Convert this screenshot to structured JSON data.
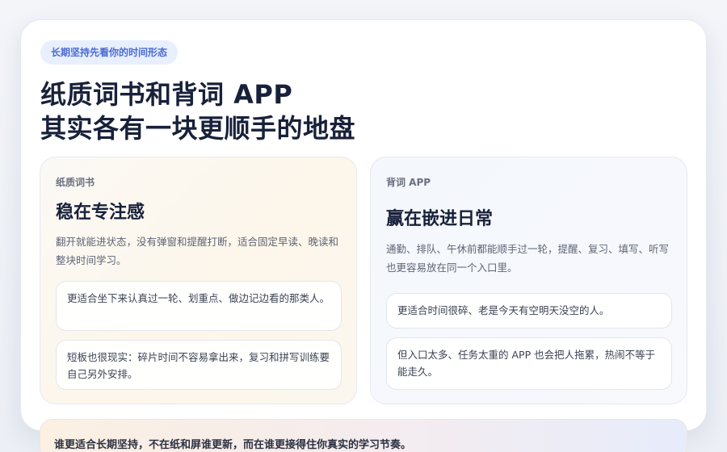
{
  "header": {
    "badge": "长期坚持先看你的时间形态",
    "title_line1": "纸质词书和背词 APP",
    "title_line2": "其实各有一块更顺手的地盘"
  },
  "panels": [
    {
      "label": "纸质词书",
      "title": "稳在专注感",
      "description": "翻开就能进状态，没有弹窗和提醒打断，适合固定早读、晚读和整块时间学习。",
      "notes": [
        "更适合坐下来认真过一轮、划重点、做边记边看的那类人。",
        "短板也很现实：碎片时间不容易拿出来，复习和拼写训练要自己另外安排。"
      ]
    },
    {
      "label": "背词 APP",
      "title": "赢在嵌进日常",
      "description": "通勤、排队、午休前都能顺手过一轮，提醒、复习、填写、听写也更容易放在同一个入口里。",
      "notes": [
        "更适合时间很碎、老是今天有空明天没空的人。",
        "但入口太多、任务太重的 APP 也会把人拖累，热闹不等于能走久。"
      ]
    }
  ],
  "footer": {
    "text": "谁更适合长期坚持，不在纸和屏谁更新，而在谁更接得住你真实的学习节奏。"
  }
}
